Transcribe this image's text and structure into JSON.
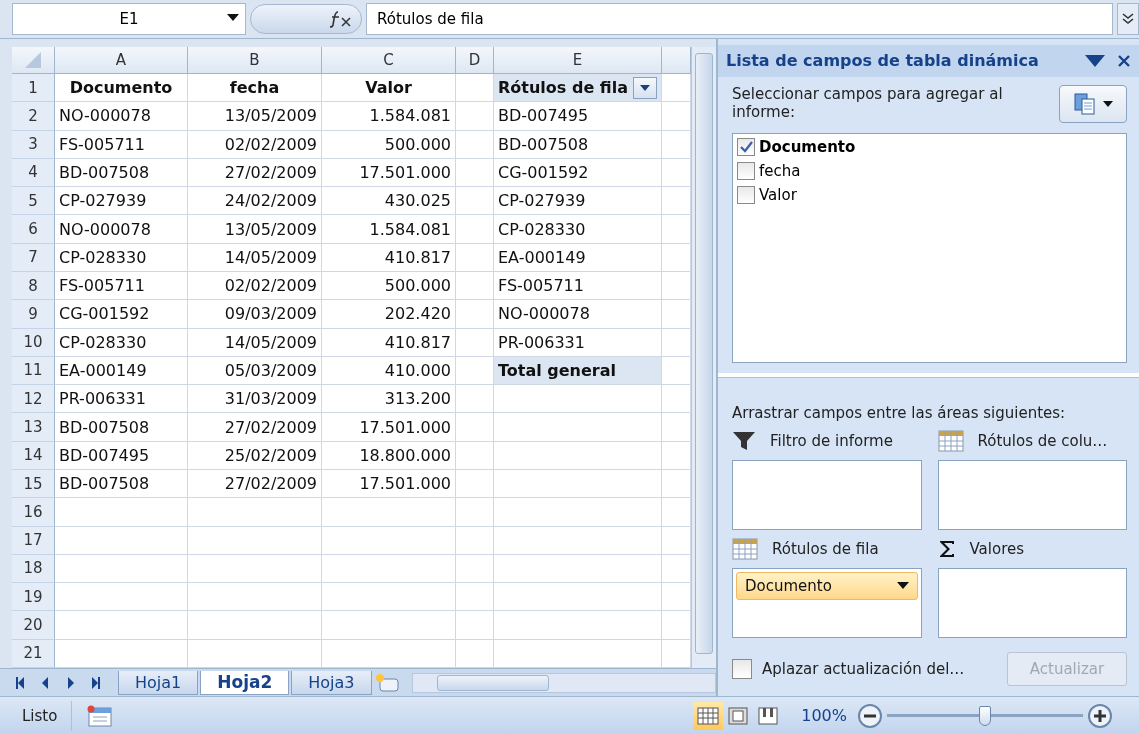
{
  "formula_bar": {
    "name_box": "E1",
    "formula": "Rótulos de fila"
  },
  "sheet": {
    "columns": [
      "A",
      "B",
      "C",
      "D",
      "E"
    ],
    "row_numbers": [
      "1",
      "2",
      "3",
      "4",
      "5",
      "6",
      "7",
      "8",
      "9",
      "10",
      "11",
      "12",
      "13",
      "14",
      "15",
      "16",
      "17",
      "18",
      "19",
      "20",
      "21"
    ],
    "table": {
      "headers": [
        "Documento",
        "fecha",
        "Valor"
      ],
      "rows": [
        [
          "NO-000078",
          "13/05/2009",
          "1.584.081"
        ],
        [
          "FS-005711",
          "02/02/2009",
          "500.000"
        ],
        [
          "BD-007508",
          "27/02/2009",
          "17.501.000"
        ],
        [
          "CP-027939",
          "24/02/2009",
          "430.025"
        ],
        [
          "NO-000078",
          "13/05/2009",
          "1.584.081"
        ],
        [
          "CP-028330",
          "14/05/2009",
          "410.817"
        ],
        [
          "FS-005711",
          "02/02/2009",
          "500.000"
        ],
        [
          "CG-001592",
          "09/03/2009",
          "202.420"
        ],
        [
          "CP-028330",
          "14/05/2009",
          "410.817"
        ],
        [
          "EA-000149",
          "05/03/2009",
          "410.000"
        ],
        [
          "PR-006331",
          "31/03/2009",
          "313.200"
        ],
        [
          "BD-007508",
          "27/02/2009",
          "17.501.000"
        ],
        [
          "BD-007495",
          "25/02/2009",
          "18.800.000"
        ],
        [
          "BD-007508",
          "27/02/2009",
          "17.501.000"
        ]
      ]
    },
    "pivot": {
      "header": "Rótulos de fila",
      "items": [
        "BD-007495",
        "BD-007508",
        "CG-001592",
        "CP-027939",
        "CP-028330",
        "EA-000149",
        "FS-005711",
        "NO-000078",
        "PR-006331"
      ],
      "total": "Total general"
    }
  },
  "sheet_tabs": [
    {
      "label": "Hoja1",
      "selected": false
    },
    {
      "label": "Hoja2",
      "selected": true
    },
    {
      "label": "Hoja3",
      "selected": false
    }
  ],
  "task_pane": {
    "title": "Lista de campos de tabla dinámica",
    "fields_label": "Seleccionar campos para agregar al informe:",
    "fields": [
      {
        "label": "Documento",
        "checked": true
      },
      {
        "label": "fecha",
        "checked": false
      },
      {
        "label": "Valor",
        "checked": false
      }
    ],
    "areas_label": "Arrastrar campos entre las áreas siguientes:",
    "areas": [
      {
        "kind": "filter",
        "label": "Filtro de informe"
      },
      {
        "kind": "columns",
        "label": "Rótulos de colu…"
      },
      {
        "kind": "rows",
        "label": "Rótulos de fila",
        "items": [
          "Documento"
        ]
      },
      {
        "kind": "values",
        "label": "Valores"
      }
    ],
    "defer": {
      "label": "Aplazar actualización del…",
      "checked": false
    },
    "update_button": {
      "label": "Actualizar",
      "disabled": true
    }
  },
  "status_bar": {
    "status": "Listo",
    "views": [
      {
        "kind": "normal",
        "selected": true
      },
      {
        "kind": "layout",
        "selected": false
      },
      {
        "kind": "break",
        "selected": false
      }
    ],
    "zoom": "100%",
    "zoom_slider": {
      "level": 0.5
    }
  }
}
